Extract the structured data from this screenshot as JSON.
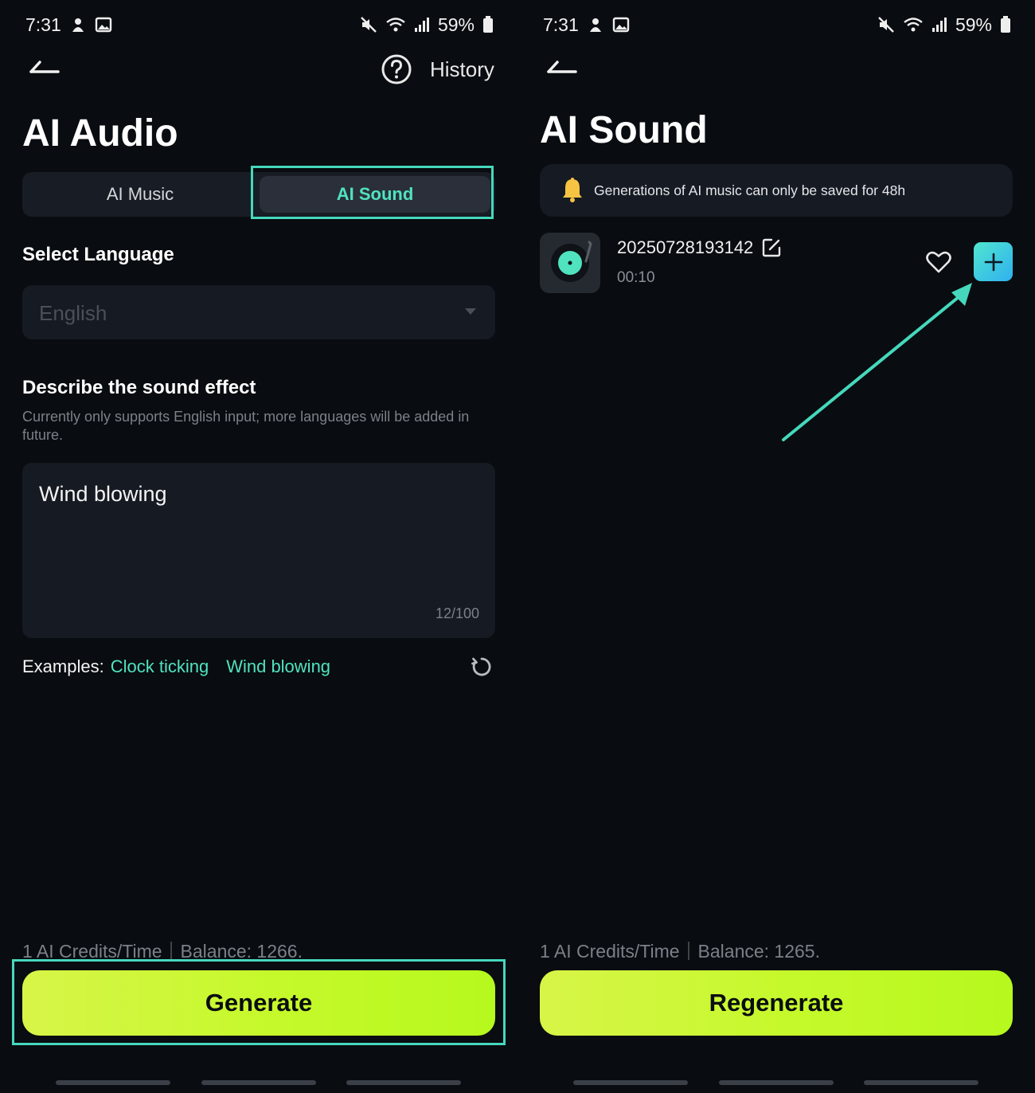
{
  "left": {
    "status": {
      "time": "7:31",
      "battery": "59%"
    },
    "header": {
      "history_label": "History"
    },
    "title": "AI Audio",
    "tabs": [
      {
        "label": "AI Music",
        "active": false
      },
      {
        "label": "AI Sound",
        "active": true
      }
    ],
    "language": {
      "label": "Select Language",
      "value": "English"
    },
    "describe": {
      "label": "Describe the sound effect",
      "hint": "Currently only supports English input; more languages will be added in future.",
      "value": "Wind blowing",
      "counter": "12/100"
    },
    "examples": {
      "label": "Examples:",
      "items": [
        "Clock ticking",
        "Wind blowing"
      ]
    },
    "credits": "1 AI Credits/Time｜Balance: 1266.",
    "generate_label": "Generate"
  },
  "right": {
    "status": {
      "time": "7:31",
      "battery": "59%"
    },
    "title": "AI Sound",
    "notice": "Generations of AI music can only be saved for 48h",
    "item": {
      "name": "20250728193142",
      "duration": "00:10"
    },
    "credits": "1 AI Credits/Time｜Balance: 1265.",
    "regenerate_label": "Regenerate"
  },
  "colors": {
    "accent": "#4fe3bf",
    "highlight": "#45d8bd",
    "button": "#c5f92a",
    "background": "#090c10"
  },
  "icons": [
    "back-arrow-icon",
    "help-icon",
    "bell-icon",
    "vinyl-icon",
    "edit-icon",
    "heart-icon",
    "plus-icon",
    "refresh-icon",
    "wifi-icon",
    "signal-icon",
    "battery-icon",
    "mute-icon"
  ]
}
